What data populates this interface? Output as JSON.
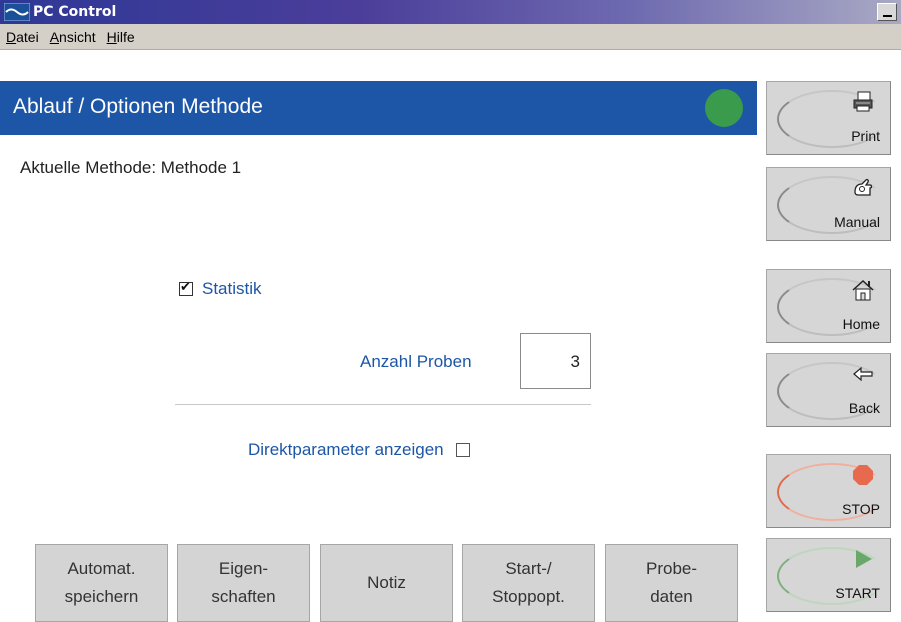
{
  "window": {
    "title": "PC Control"
  },
  "menu": {
    "items": [
      {
        "label": "Datei",
        "mnemonic": "D",
        "rest": "atei"
      },
      {
        "label": "Ansicht",
        "mnemonic": "A",
        "rest": "nsicht"
      },
      {
        "label": "Hilfe",
        "mnemonic": "H",
        "rest": "ilfe"
      }
    ]
  },
  "header": {
    "title": "Ablauf / Optionen Methode",
    "status_color": "#3a9b4c"
  },
  "method": {
    "label": "Aktuelle Methode: Methode 1"
  },
  "options": {
    "statistik_label": "Statistik",
    "statistik_checked": true,
    "anzahl_label": "Anzahl Proben",
    "anzahl_value": "3",
    "direkt_label": "Direktparameter anzeigen",
    "direkt_checked": false
  },
  "bottom_buttons": [
    {
      "label": "Automat.\nspeichern"
    },
    {
      "label": "Eigen-\nschaften"
    },
    {
      "label": "Notiz"
    },
    {
      "label": "Start-/\nStoppopt."
    },
    {
      "label": "Probe-\ndaten"
    }
  ],
  "side_buttons": {
    "print": {
      "label": "Print",
      "icon": "printer-icon"
    },
    "manual": {
      "label": "Manual",
      "icon": "hand-icon"
    },
    "home": {
      "label": "Home",
      "icon": "home-icon"
    },
    "back": {
      "label": "Back",
      "icon": "back-arrow-icon"
    },
    "stop": {
      "label": "STOP",
      "icon": "stop-octagon-icon"
    },
    "start": {
      "label": "START",
      "icon": "play-triangle-icon"
    }
  },
  "colors": {
    "header_blue": "#1d56a6",
    "label_blue": "#1d56a6",
    "stop_red": "#e86a4e",
    "start_green": "#69a86a"
  }
}
